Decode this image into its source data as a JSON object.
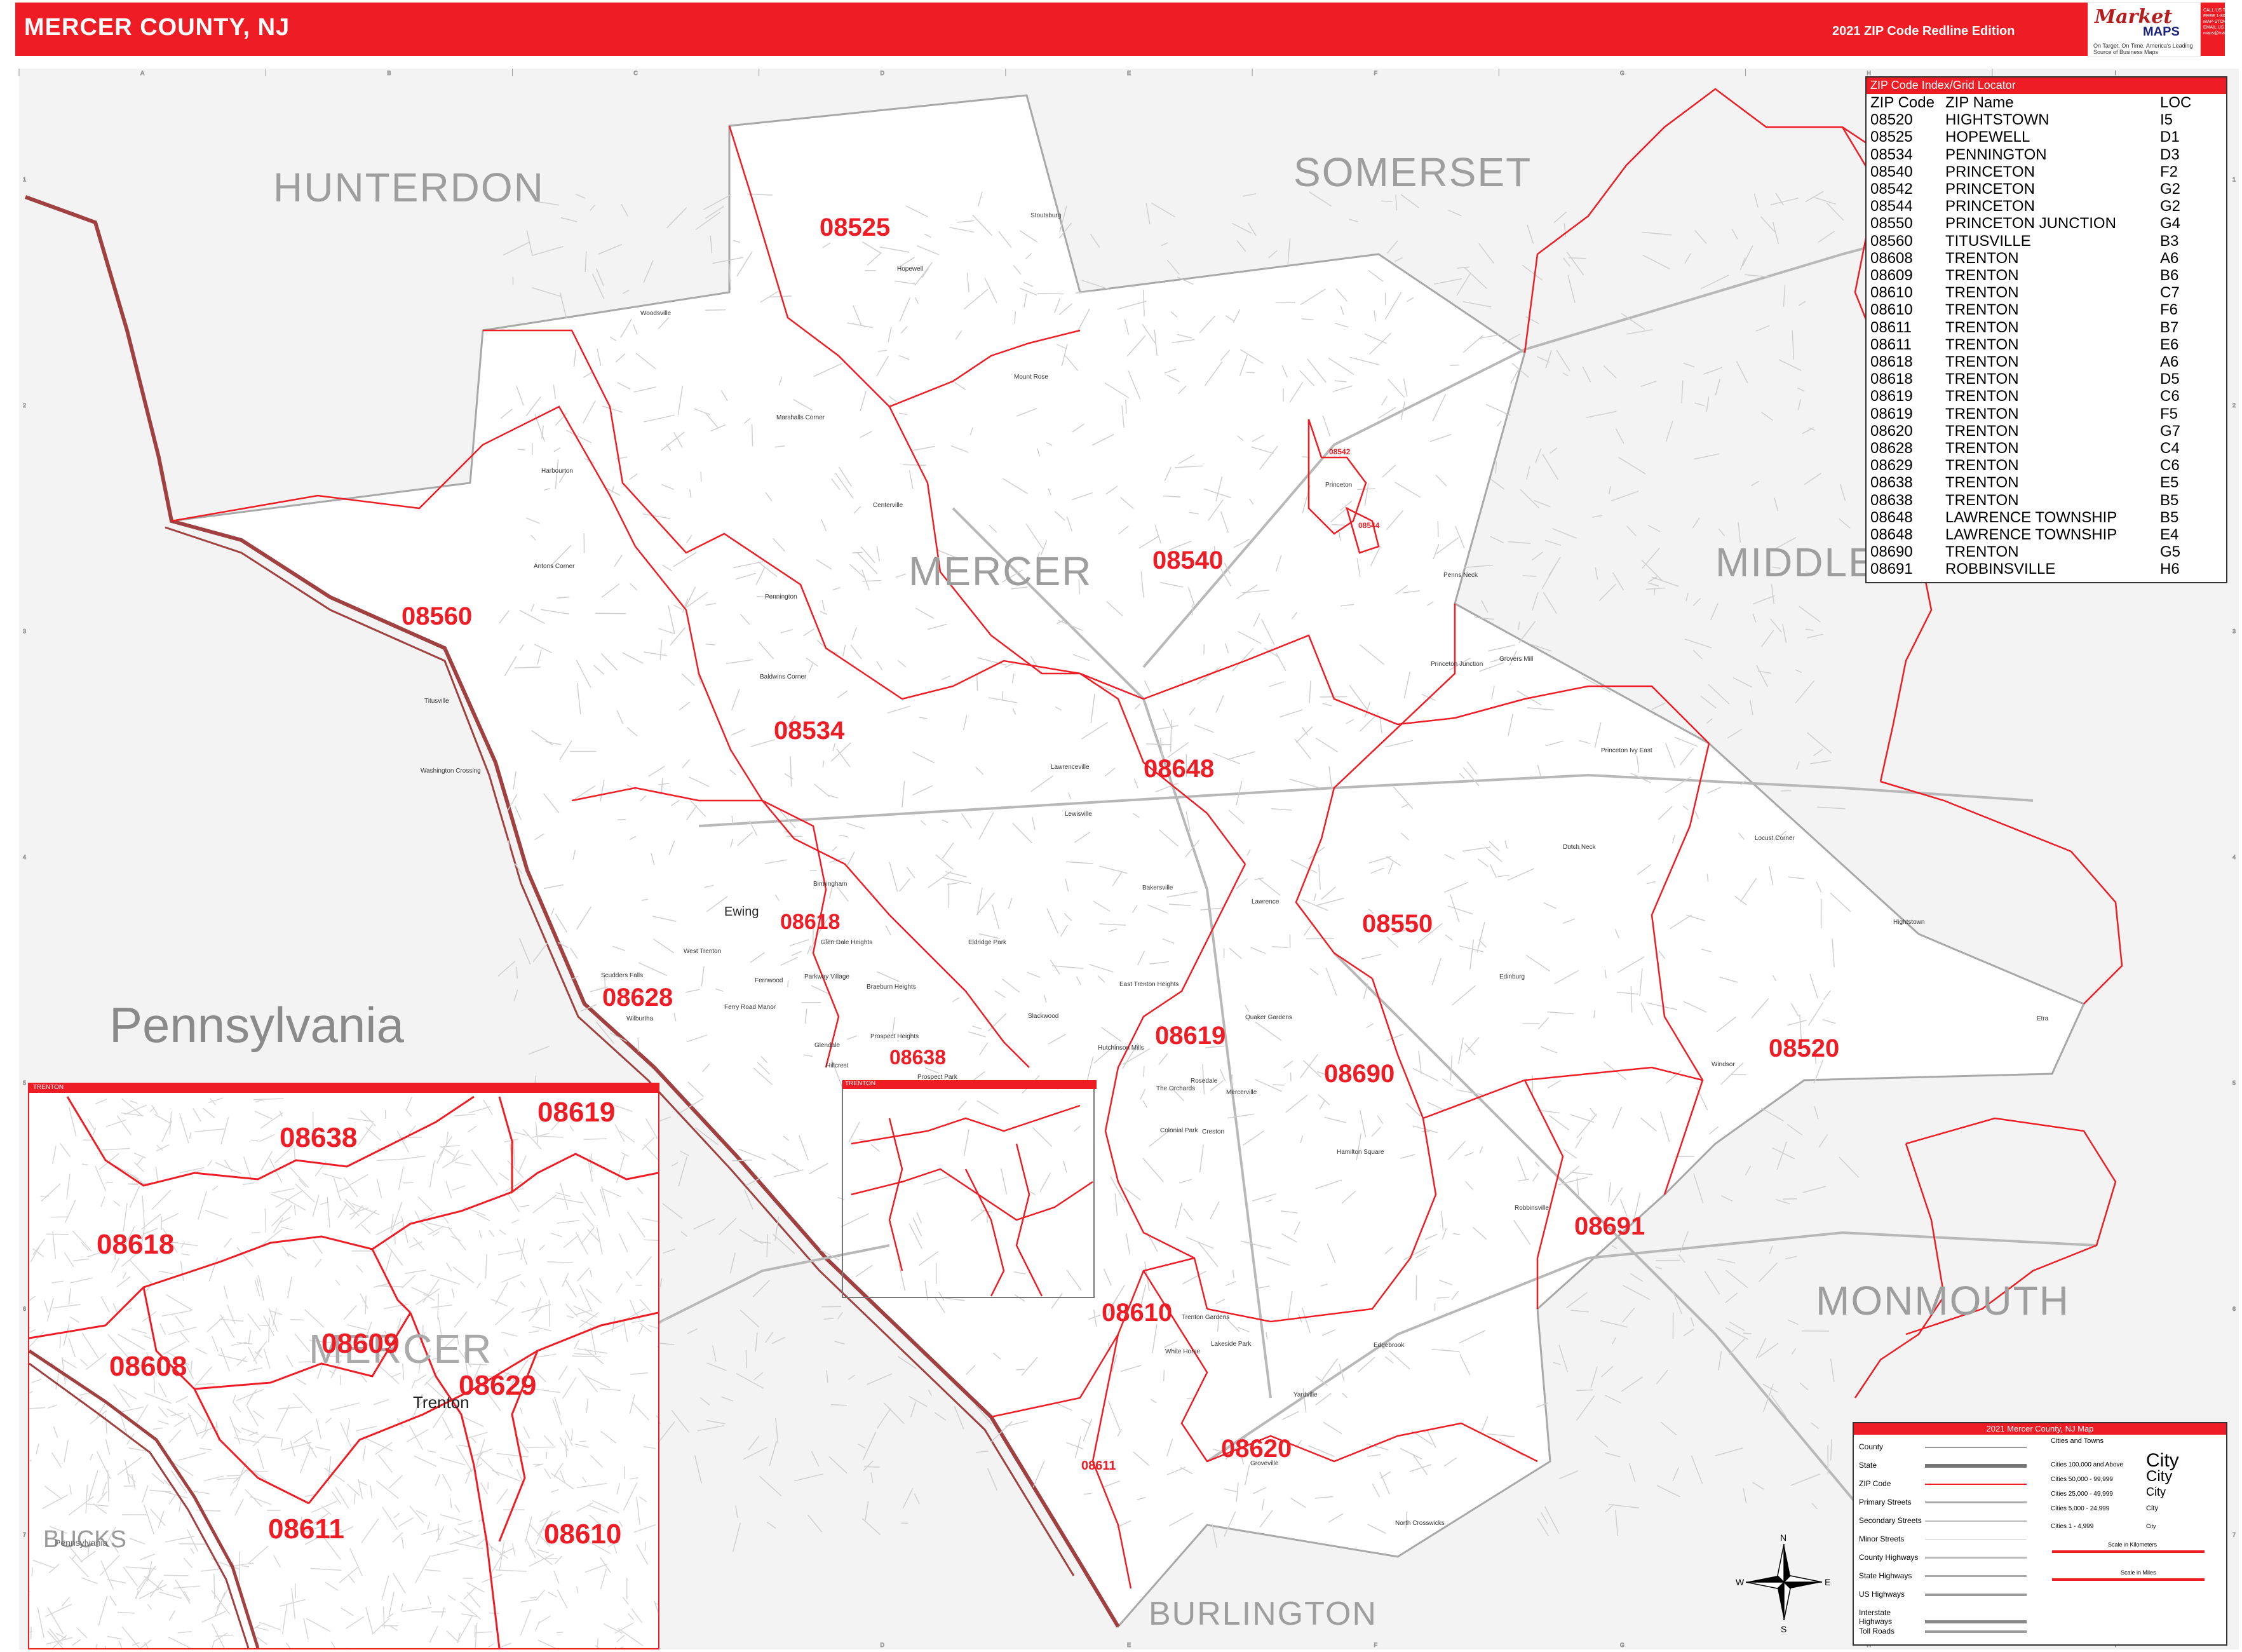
{
  "header": {
    "title": "MERCER COUNTY, NJ",
    "edition": "2021 ZIP Code Redline Edition",
    "logo_top": "Market",
    "logo_bottom": "MAPS",
    "logo_tagline": "On Target, On Time. America's Leading Source of Business Maps",
    "contact": "CALL US TOLL FREE 1-800-MAP-STORE EMAIL US AT maps@marketmaps.com"
  },
  "colors": {
    "redline": "#ee1c24",
    "county_line": "#9e9e9e",
    "background": "#f3f3f3",
    "mercer_fill": "#ffffff"
  },
  "grid": {
    "columns": [
      "A",
      "B",
      "C",
      "D",
      "E",
      "F",
      "G",
      "H",
      "I"
    ],
    "rows": [
      "1",
      "2",
      "3",
      "4",
      "5",
      "6",
      "7"
    ]
  },
  "counties": [
    "HUNTERDON",
    "SOMERSET",
    "MERCER",
    "MIDDLE",
    "MONMOUTH",
    "BURLINGTON"
  ],
  "state_label": "Pennsylvania",
  "zip_labels": [
    "08525",
    "08560",
    "08540",
    "08534",
    "08648",
    "08550",
    "08618",
    "08628",
    "08638",
    "08619",
    "08690",
    "08520",
    "08691",
    "08610",
    "08620",
    "08611",
    "08544",
    "08542"
  ],
  "towns": [
    "Woodsville",
    "Hopewell",
    "Mount Rose",
    "Stoutsburg",
    "Marshalls Corner",
    "Harbourton",
    "Centerville",
    "Pennington",
    "Antons Corner",
    "Titusville",
    "Baldwins Corner",
    "Washington Crossing",
    "Lawrenceville",
    "Lewisville",
    "Ewing",
    "Birmingham",
    "Glen Dale Heights",
    "West Trenton",
    "Scudders Falls",
    "Wilburtha",
    "Fernwood",
    "Ferry Road Manor",
    "Parkway Village",
    "Braeburn Heights",
    "Prospect Heights",
    "Prospect Park",
    "Eldridge Park",
    "Slackwood",
    "Glendale",
    "Hillcrest",
    "East Trenton Heights",
    "Hutchinson Mills",
    "Quaker Gardens",
    "The Orchards",
    "Rosedale",
    "Mercerville",
    "Colonial Park",
    "Creston",
    "Hamilton Square",
    "Robbinsville",
    "Windsor",
    "Edinburg",
    "Princeton Junction",
    "Grovers Mill",
    "Penns Neck",
    "Princeton",
    "Princeton Ivy East",
    "Dutch Neck",
    "Lawrence",
    "Hightstown",
    "Etra",
    "Locust Corner",
    "Trenton Gardens",
    "White Horse",
    "Lakeside Park",
    "Yardville",
    "Edgebrook",
    "Groveville",
    "North Crosswicks",
    "Bakersville"
  ],
  "index": {
    "title": "ZIP Code Index/Grid Locator",
    "columns": [
      "ZIP Code",
      "ZIP Name",
      "LOC"
    ],
    "rows": [
      [
        "08520",
        "HIGHTSTOWN",
        "I5"
      ],
      [
        "08525",
        "HOPEWELL",
        "D1"
      ],
      [
        "08534",
        "PENNINGTON",
        "D3"
      ],
      [
        "08540",
        "PRINCETON",
        "F2"
      ],
      [
        "08542",
        "PRINCETON",
        "G2"
      ],
      [
        "08544",
        "PRINCETON",
        "G2"
      ],
      [
        "08550",
        "PRINCETON JUNCTION",
        "G4"
      ],
      [
        "08560",
        "TITUSVILLE",
        "B3"
      ],
      [
        "08608",
        "TRENTON",
        "A6"
      ],
      [
        "08609",
        "TRENTON",
        "B6"
      ],
      [
        "08610",
        "TRENTON",
        "C7"
      ],
      [
        "08610",
        "TRENTON",
        "F6"
      ],
      [
        "08611",
        "TRENTON",
        "B7"
      ],
      [
        "08611",
        "TRENTON",
        "E6"
      ],
      [
        "08618",
        "TRENTON",
        "A6"
      ],
      [
        "08618",
        "TRENTON",
        "D5"
      ],
      [
        "08619",
        "TRENTON",
        "C6"
      ],
      [
        "08619",
        "TRENTON",
        "F5"
      ],
      [
        "08620",
        "TRENTON",
        "G7"
      ],
      [
        "08628",
        "TRENTON",
        "C4"
      ],
      [
        "08629",
        "TRENTON",
        "C6"
      ],
      [
        "08638",
        "TRENTON",
        "E5"
      ],
      [
        "08638",
        "TRENTON",
        "B5"
      ],
      [
        "08648",
        "LAWRENCE TOWNSHIP",
        "B5"
      ],
      [
        "08648",
        "LAWRENCE TOWNSHIP",
        "E4"
      ],
      [
        "08690",
        "TRENTON",
        "G5"
      ],
      [
        "08691",
        "ROBBINSVILLE",
        "H6"
      ]
    ]
  },
  "inset": {
    "title": "TRENTON",
    "zips": [
      "08638",
      "08619",
      "08618",
      "08609",
      "08608",
      "08629",
      "08611",
      "08610"
    ],
    "labels": {
      "county": "MERCER",
      "city": "Trenton",
      "bucks": "BUCKS",
      "pa": "Pennsylvania"
    }
  },
  "legend": {
    "title": "2021 Mercer County, NJ Map",
    "items": [
      "County",
      "State",
      "ZIP Code",
      "Primary Streets",
      "Secondary Streets",
      "Minor Streets",
      "County Highways",
      "State Highways",
      "US Highways",
      "Interstate Highways",
      "Toll Roads"
    ],
    "cities_title": "Cities and Towns",
    "cities": [
      {
        "range": "Cities 100,000 and Above",
        "sample": "City"
      },
      {
        "range": "Cities 50,000 - 99,999",
        "sample": "City"
      },
      {
        "range": "Cities 25,000 - 49,999",
        "sample": "City"
      },
      {
        "range": "Cities 5,000 - 24,999",
        "sample": "City"
      },
      {
        "range": "Cities 1 - 4,999",
        "sample": "City"
      }
    ],
    "scale_km": "Scale in Kilometers",
    "scale_mi": "Scale in Miles"
  },
  "compass": {
    "n": "N",
    "s": "S",
    "e": "E",
    "w": "W"
  }
}
